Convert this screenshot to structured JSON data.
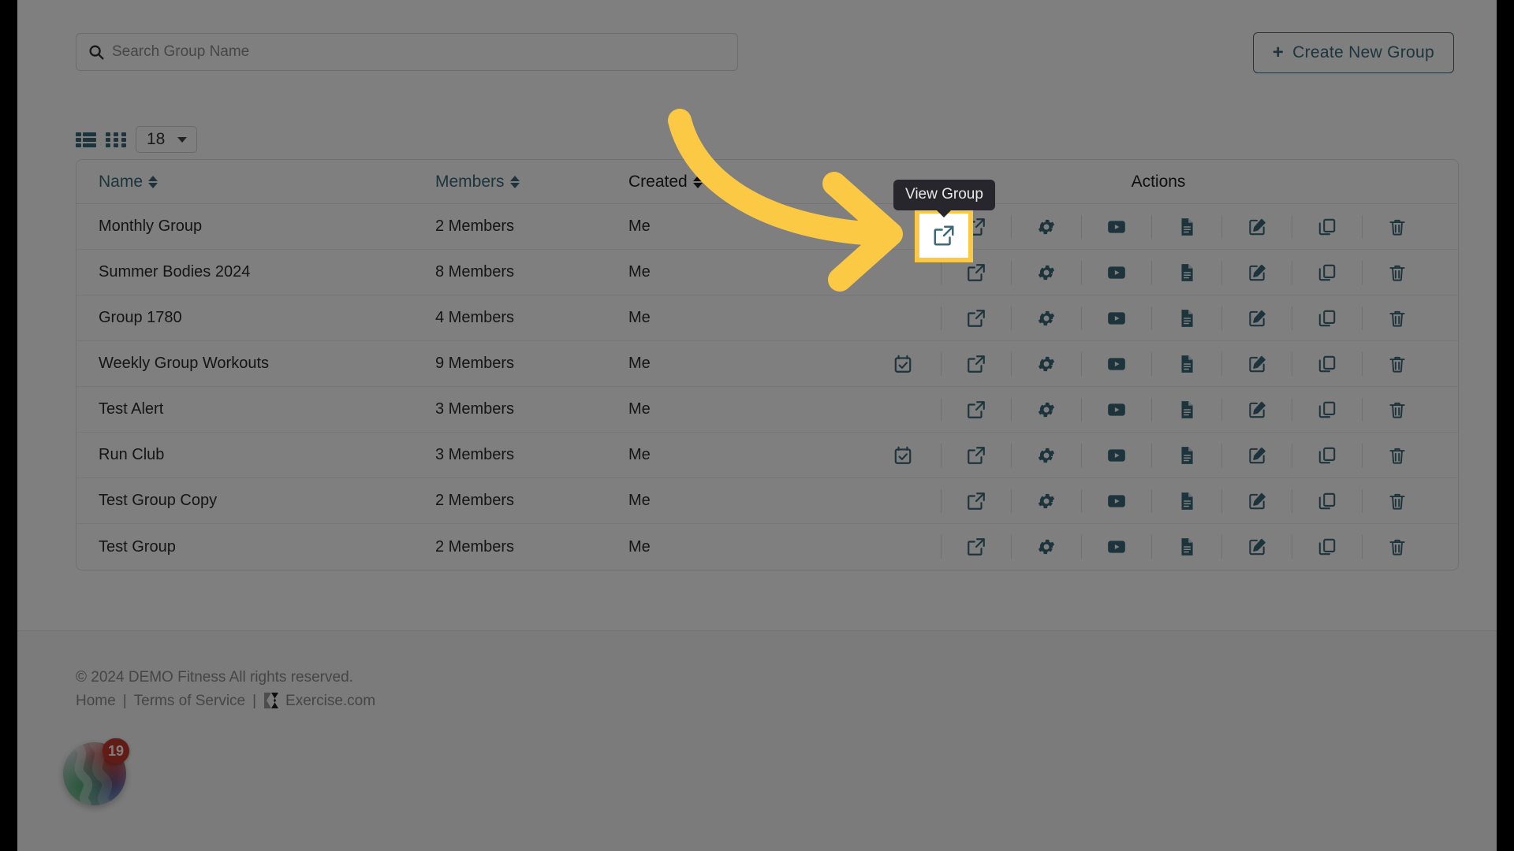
{
  "search": {
    "placeholder": "Search Group Name",
    "value": "",
    "icon": "search-icon"
  },
  "header": {
    "create_button": "Create New Group",
    "create_icon": "plus-icon"
  },
  "toolbar": {
    "list_view_icon": "list-view-icon",
    "grid_view_icon": "grid-view-icon",
    "per_page_value": "18",
    "caret_icon": "chevron-down-icon"
  },
  "table": {
    "columns": [
      {
        "label": "Name",
        "sortable": true,
        "accent": true
      },
      {
        "label": "Members",
        "sortable": true,
        "accent": true
      },
      {
        "label": "Created",
        "sortable": true,
        "accent": false
      },
      {
        "label": "Actions",
        "sortable": false,
        "accent": false
      }
    ],
    "rows": [
      {
        "name": "Monthly Group",
        "members": "2 Members",
        "created": "Me",
        "has_calendar": false
      },
      {
        "name": "Summer Bodies 2024",
        "members": "8 Members",
        "created": "Me",
        "has_calendar": false
      },
      {
        "name": "Group 1780",
        "members": "4 Members",
        "created": "Me",
        "has_calendar": false
      },
      {
        "name": "Weekly Group Workouts",
        "members": "9 Members",
        "created": "Me",
        "has_calendar": true
      },
      {
        "name": "Test Alert",
        "members": "3 Members",
        "created": "Me",
        "has_calendar": false
      },
      {
        "name": "Run Club",
        "members": "3 Members",
        "created": "Me",
        "has_calendar": true
      },
      {
        "name": "Test Group Copy",
        "members": "2 Members",
        "created": "Me",
        "has_calendar": false
      },
      {
        "name": "Test Group",
        "members": "2 Members",
        "created": "Me",
        "has_calendar": false
      }
    ],
    "action_icons": [
      "external-link-icon",
      "gear-icon",
      "video-icon",
      "document-icon",
      "edit-icon",
      "copy-icon",
      "trash-icon"
    ]
  },
  "tooltip": {
    "text": "View Group"
  },
  "highlight": {
    "icon": "external-link-icon",
    "border_color": "#fcc944"
  },
  "annotation": {
    "arrow_color": "#fcc944"
  },
  "footer": {
    "copyright": "© 2024 DEMO Fitness All rights reserved.",
    "home": "Home",
    "terms": "Terms of Service",
    "exercise": "Exercise.com",
    "separator": "|"
  },
  "chat": {
    "badge_count": "19",
    "icon": "chat-widget-icon"
  },
  "colors": {
    "accent": "#3c6878",
    "highlight": "#fcc944",
    "badge": "#c0392b",
    "tooltip_bg": "#26262c"
  }
}
